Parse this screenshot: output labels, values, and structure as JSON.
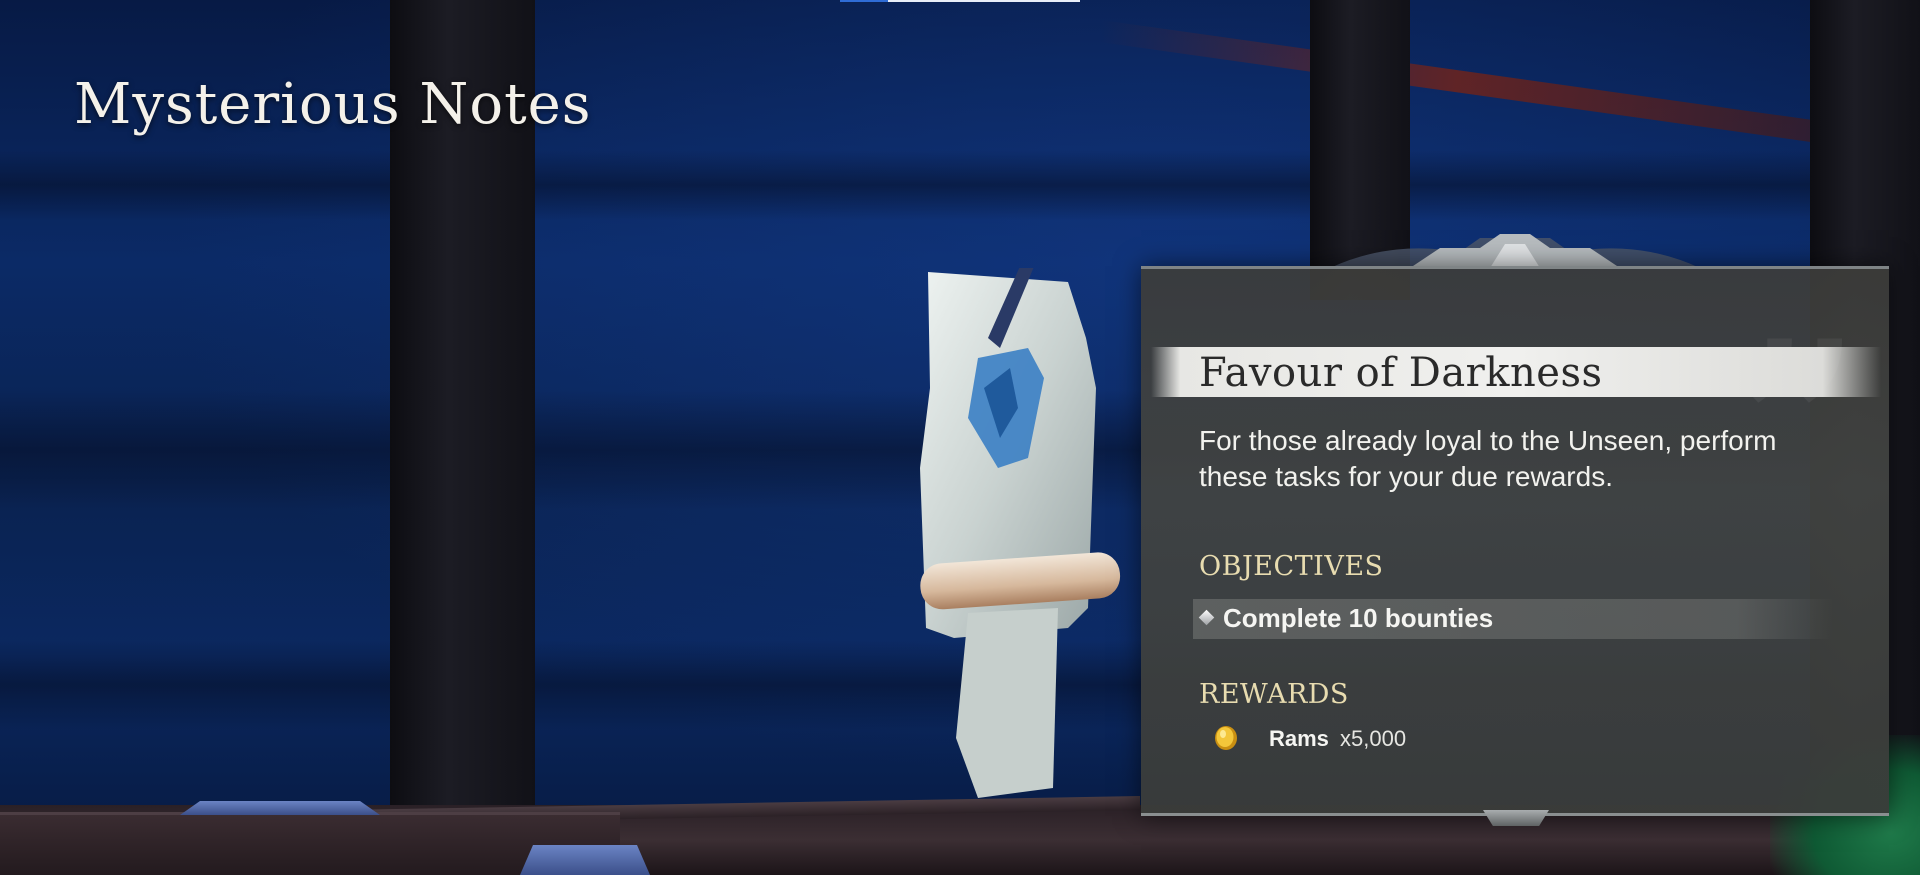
{
  "page": {
    "title": "Mysterious Notes"
  },
  "quest": {
    "title": "Favour of Darkness",
    "description": "For those already loyal to the Unseen, perform these tasks for your due rewards.",
    "objectives_heading": "OBJECTIVES",
    "objectives": [
      {
        "text": "Complete 10 bounties",
        "icon": "diamond-bullet-icon"
      }
    ],
    "rewards_heading": "REWARDS",
    "rewards": [
      {
        "name": "Rams",
        "quantity": "x5,000",
        "icon": "gold-coin-icon"
      }
    ]
  },
  "colors": {
    "heading_gold": "#e8dcb0",
    "panel_bg": "#3f403e",
    "banner": "#ececea",
    "scene_blue": "#0b2a66"
  }
}
